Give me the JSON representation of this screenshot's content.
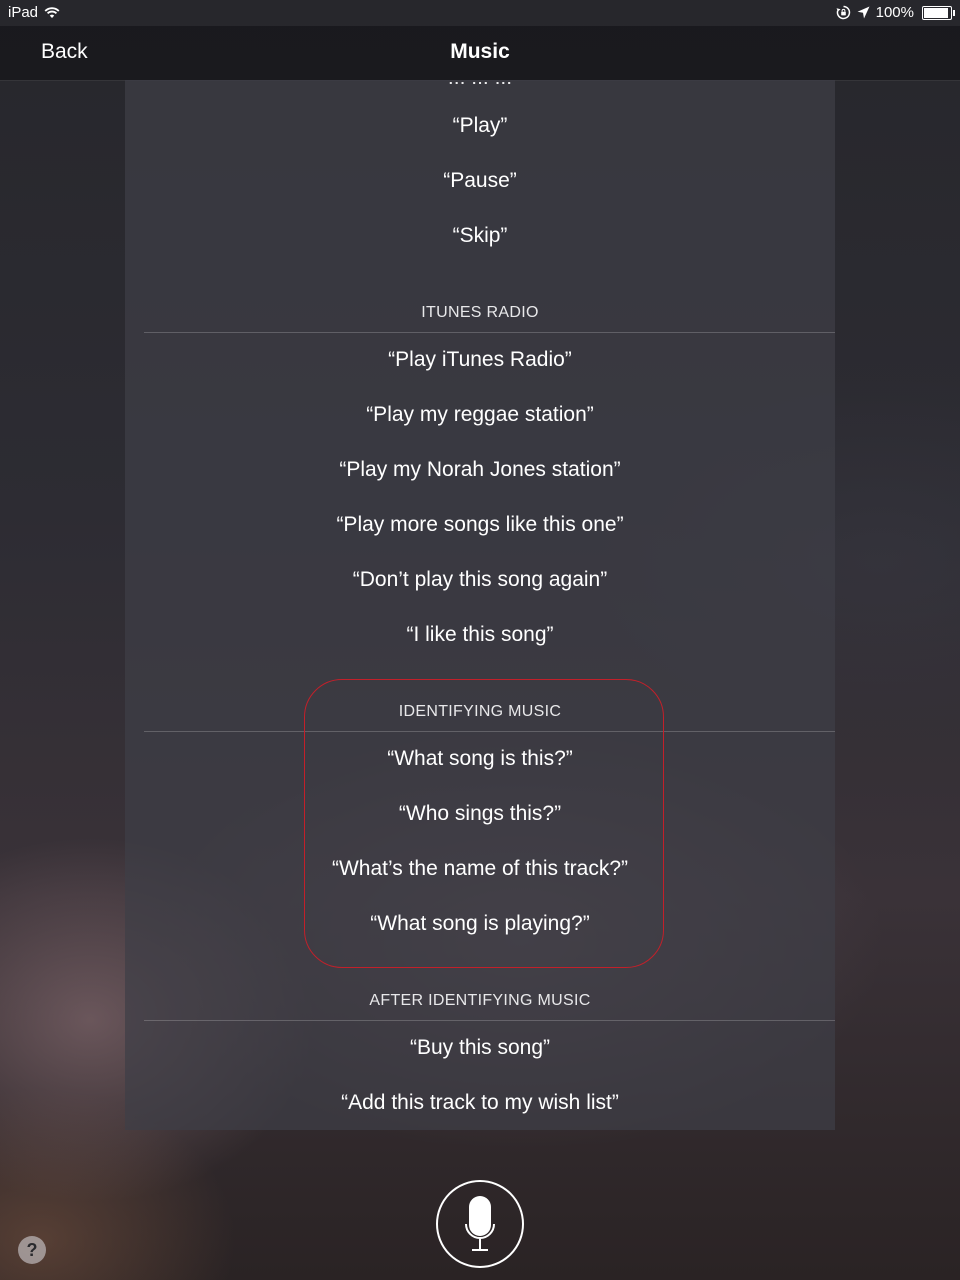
{
  "status_bar": {
    "device": "iPad",
    "battery": "100%",
    "battery_level": 1.0,
    "icons": [
      "wifi-icon",
      "rotation-lock-icon",
      "location-arrow-icon",
      "battery-icon"
    ]
  },
  "nav": {
    "back_label": "Back",
    "title": "Music"
  },
  "panel": {
    "cutoff_text": "“... ... ...”",
    "groups": [
      {
        "header": "",
        "phrases": [
          "“Play”",
          "“Pause”",
          "“Skip”"
        ]
      },
      {
        "header": "ITUNES RADIO",
        "phrases": [
          "“Play iTunes Radio”",
          "“Play my reggae station”",
          "“Play my Norah Jones station”",
          "“Play more songs like this one”",
          "“Don’t play this song again”",
          "“I like this song”"
        ]
      },
      {
        "header": "IDENTIFYING MUSIC",
        "phrases": [
          "“What song is this?”",
          "“Who sings this?”",
          "“What’s the name of this track?”",
          "“What song is playing?”"
        ],
        "highlighted": true,
        "highlight_color": "#c2202a"
      },
      {
        "header": "AFTER IDENTIFYING MUSIC",
        "phrases": [
          "“Buy this song”",
          "“Add this track to my wish list”"
        ]
      }
    ]
  },
  "footer": {
    "mic_icon": "microphone-icon",
    "help_label": "?"
  }
}
